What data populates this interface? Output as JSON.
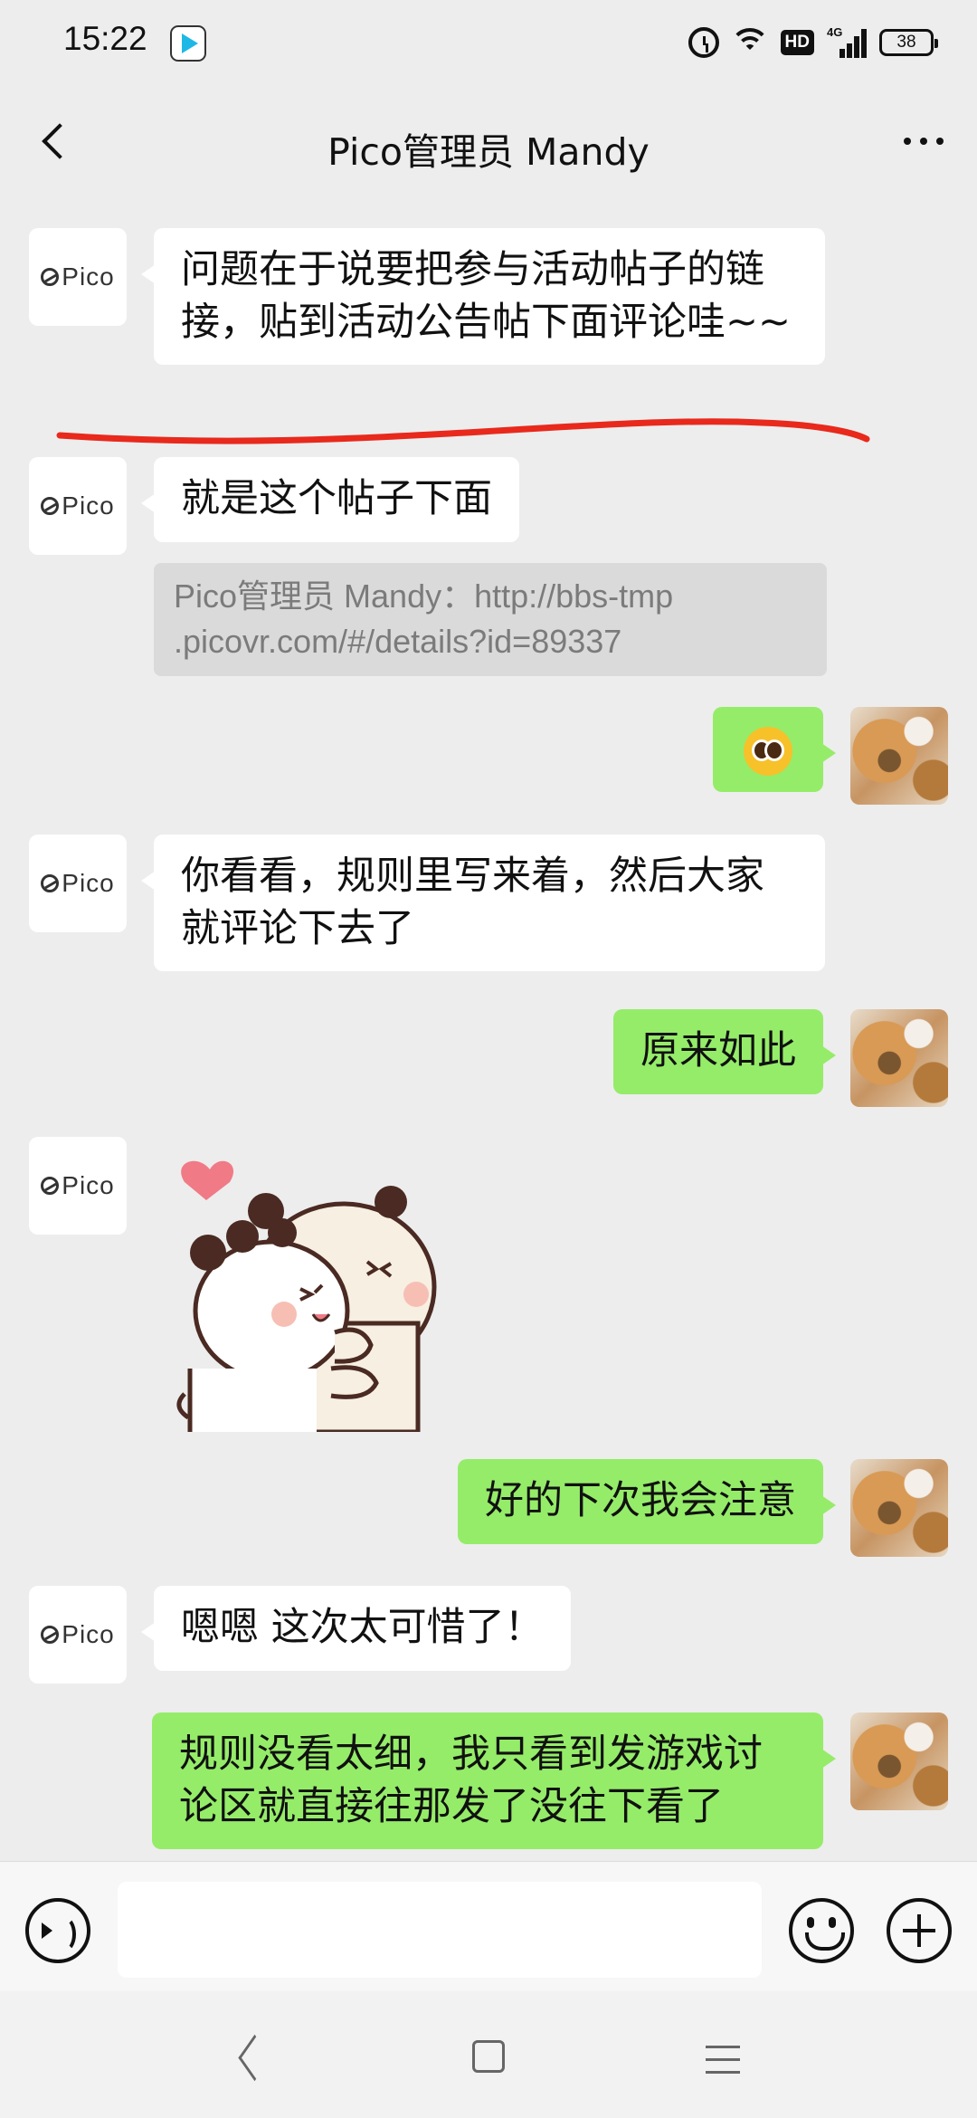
{
  "status_bar": {
    "time": "15:22",
    "hd_label": "HD",
    "network_label": "4G",
    "battery": "38"
  },
  "header": {
    "title": "Pico管理员 Mandy"
  },
  "pico_avatar_text": "Pico",
  "messages": {
    "m1": "问题在于说要把参与活动帖子的链接，贴到活动公告帖下面评论哇~~",
    "m2": "就是这个帖子下面",
    "m2_quote_line1": "Pico管理员 Mandy：http://bbs-tmp",
    "m2_quote_line2": ".picovr.com/#/details?id=89337",
    "m3_emoji": "pleading-face",
    "m4": "你看看，规则里写来着，然后大家就评论下去了",
    "m5": "原来如此",
    "m6_sticker": "hugging-bears-sticker",
    "m7": "好的下次我会注意",
    "m8": "嗯嗯 这次太可惜了！",
    "m9": "规则没看太细，我只看到发游戏讨论区就直接往那发了没往下看了"
  },
  "input_bar": {
    "placeholder": ""
  },
  "colors": {
    "background": "#ededed",
    "incoming_bubble": "#ffffff",
    "outgoing_bubble": "#95ec69",
    "annotation_underline": "#e8291c"
  }
}
